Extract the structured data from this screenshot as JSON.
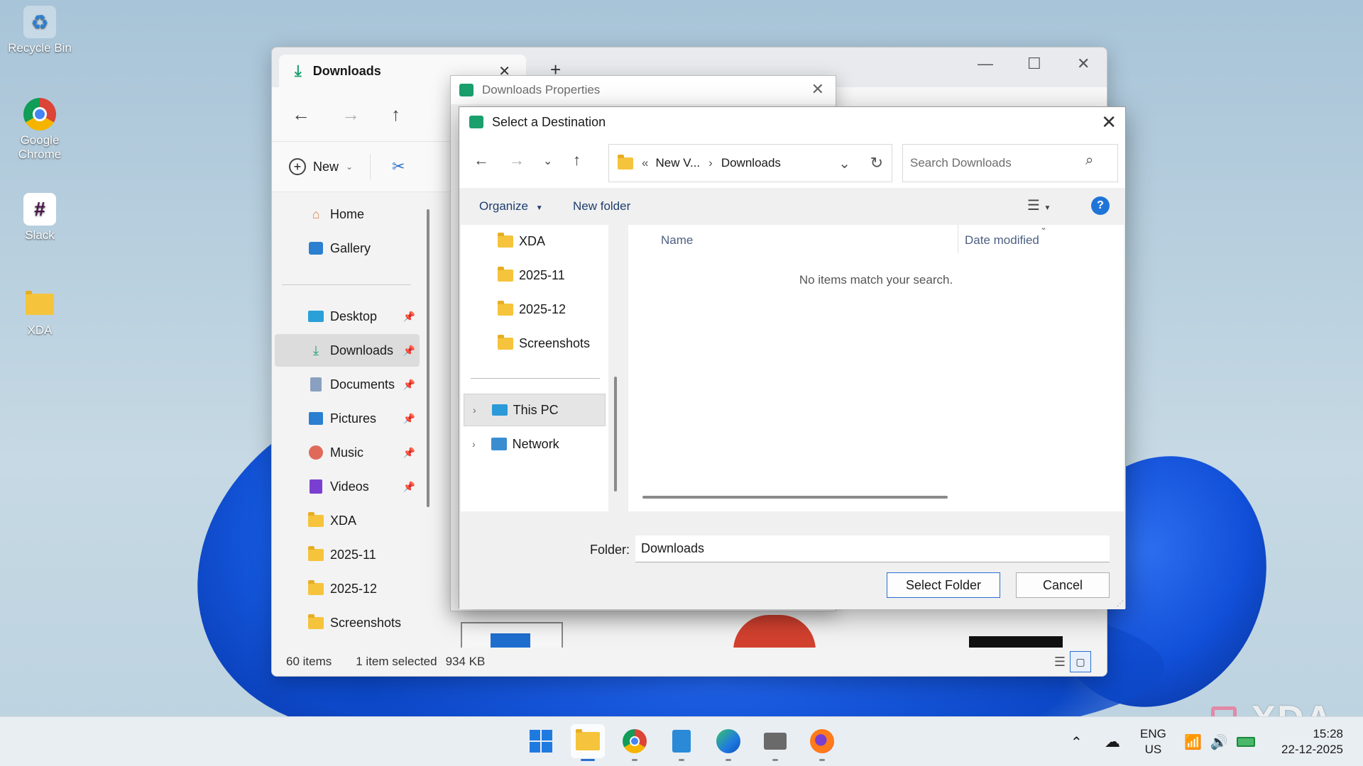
{
  "desktop": {
    "icons": [
      {
        "label": "Recycle Bin"
      },
      {
        "label": "Google Chrome"
      },
      {
        "label": "Slack"
      },
      {
        "label": "XDA"
      }
    ]
  },
  "explorer": {
    "tab_title": "Downloads",
    "command_new": "New",
    "sidebar": {
      "home": "Home",
      "gallery": "Gallery",
      "desktop": "Desktop",
      "downloads": "Downloads",
      "documents": "Documents",
      "pictures": "Pictures",
      "music": "Music",
      "videos": "Videos",
      "xda": "XDA",
      "f2025_11": "2025-11",
      "f2025_12": "2025-12",
      "screenshots": "Screenshots"
    },
    "status": {
      "items": "60 items",
      "selected": "1 item selected",
      "size": "934 KB"
    }
  },
  "properties_dialog": {
    "title": "Downloads Properties"
  },
  "destination_dialog": {
    "title": "Select a Destination",
    "address": {
      "overflow": "«",
      "segment1": "New V...",
      "separator": "›",
      "segment2": "Downloads"
    },
    "search_placeholder": "Search Downloads",
    "toolbar": {
      "organize": "Organize",
      "new_folder": "New folder"
    },
    "tree": {
      "xda": "XDA",
      "f2025_11": "2025-11",
      "f2025_12": "2025-12",
      "screenshots": "Screenshots",
      "this_pc": "This PC",
      "network": "Network"
    },
    "columns": {
      "name": "Name",
      "date_modified": "Date modified"
    },
    "empty_message": "No items match your search.",
    "folder_label": "Folder:",
    "folder_value": "Downloads",
    "select_button": "Select Folder",
    "cancel_button": "Cancel"
  },
  "taskbar": {
    "language": "ENG",
    "region": "US",
    "time": "15:28",
    "date": "22-12-2025"
  },
  "watermark": "XDA",
  "colors": {
    "accent": "#2a6fd0",
    "download_green": "#1aa06d",
    "folder_yellow": "#f5c43c"
  }
}
